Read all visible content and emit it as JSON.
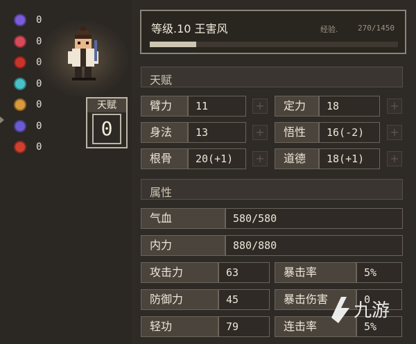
{
  "status_effects": [
    {
      "icon": "purple-skull-icon",
      "color": "#7a5bd8",
      "count": "0"
    },
    {
      "icon": "broken-heart-icon",
      "color": "#d84a5a",
      "count": "0"
    },
    {
      "icon": "red-spider-icon",
      "color": "#c8342c",
      "count": "0"
    },
    {
      "icon": "cyan-face-icon",
      "color": "#49c0c8",
      "count": "0"
    },
    {
      "icon": "dizzy-star-icon",
      "color": "#d89a3c",
      "count": "0"
    },
    {
      "icon": "purple-mask-icon",
      "color": "#6a5cd0",
      "count": "0"
    },
    {
      "icon": "red-flame-icon",
      "color": "#d0402e",
      "count": "0"
    }
  ],
  "talent_badge": {
    "label": "天赋",
    "value": "0"
  },
  "header": {
    "level_name": "等级.10 王害风",
    "exp_label": "经验.",
    "exp_value": "270/1450",
    "exp_progress": 0.186
  },
  "sections": {
    "talent": "天赋",
    "attributes": "属性"
  },
  "talents": [
    {
      "label": "臂力",
      "value": "11"
    },
    {
      "label": "定力",
      "value": "18"
    },
    {
      "label": "身法",
      "value": "13"
    },
    {
      "label": "悟性",
      "value": "16(-2)"
    },
    {
      "label": "根骨",
      "value": "20(+1)"
    },
    {
      "label": "道德",
      "value": "18(+1)"
    }
  ],
  "attributes": {
    "hp": {
      "label": "气血",
      "value": "580/580"
    },
    "mp": {
      "label": "内力",
      "value": "880/880"
    },
    "attack": {
      "label": "攻击力",
      "value": "63"
    },
    "crit": {
      "label": "暴击率",
      "value": "5%"
    },
    "defense": {
      "label": "防御力",
      "value": "45"
    },
    "crit_dmg": {
      "label": "暴击伤害",
      "value": "0"
    },
    "agility": {
      "label": "轻功",
      "value": "79"
    },
    "combo": {
      "label": "连击率",
      "value": "5%"
    }
  },
  "plus_symbol": "+",
  "watermark": "九游",
  "colors": {
    "watermark": "#ffffff",
    "exp_fill": "#cfc6b2"
  }
}
